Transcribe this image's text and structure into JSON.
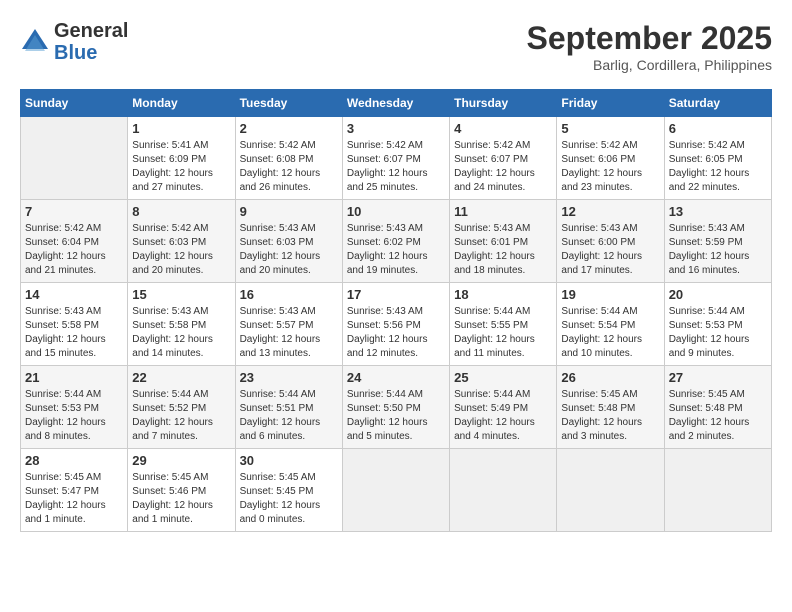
{
  "header": {
    "logo_general": "General",
    "logo_blue": "Blue",
    "month_title": "September 2025",
    "subtitle": "Barlig, Cordillera, Philippines"
  },
  "weekdays": [
    "Sunday",
    "Monday",
    "Tuesday",
    "Wednesday",
    "Thursday",
    "Friday",
    "Saturday"
  ],
  "weeks": [
    [
      {
        "day": "",
        "sunrise": "",
        "sunset": "",
        "daylight": ""
      },
      {
        "day": "1",
        "sunrise": "Sunrise: 5:41 AM",
        "sunset": "Sunset: 6:09 PM",
        "daylight": "Daylight: 12 hours and 27 minutes."
      },
      {
        "day": "2",
        "sunrise": "Sunrise: 5:42 AM",
        "sunset": "Sunset: 6:08 PM",
        "daylight": "Daylight: 12 hours and 26 minutes."
      },
      {
        "day": "3",
        "sunrise": "Sunrise: 5:42 AM",
        "sunset": "Sunset: 6:07 PM",
        "daylight": "Daylight: 12 hours and 25 minutes."
      },
      {
        "day": "4",
        "sunrise": "Sunrise: 5:42 AM",
        "sunset": "Sunset: 6:07 PM",
        "daylight": "Daylight: 12 hours and 24 minutes."
      },
      {
        "day": "5",
        "sunrise": "Sunrise: 5:42 AM",
        "sunset": "Sunset: 6:06 PM",
        "daylight": "Daylight: 12 hours and 23 minutes."
      },
      {
        "day": "6",
        "sunrise": "Sunrise: 5:42 AM",
        "sunset": "Sunset: 6:05 PM",
        "daylight": "Daylight: 12 hours and 22 minutes."
      }
    ],
    [
      {
        "day": "7",
        "sunrise": "Sunrise: 5:42 AM",
        "sunset": "Sunset: 6:04 PM",
        "daylight": "Daylight: 12 hours and 21 minutes."
      },
      {
        "day": "8",
        "sunrise": "Sunrise: 5:42 AM",
        "sunset": "Sunset: 6:03 PM",
        "daylight": "Daylight: 12 hours and 20 minutes."
      },
      {
        "day": "9",
        "sunrise": "Sunrise: 5:43 AM",
        "sunset": "Sunset: 6:03 PM",
        "daylight": "Daylight: 12 hours and 20 minutes."
      },
      {
        "day": "10",
        "sunrise": "Sunrise: 5:43 AM",
        "sunset": "Sunset: 6:02 PM",
        "daylight": "Daylight: 12 hours and 19 minutes."
      },
      {
        "day": "11",
        "sunrise": "Sunrise: 5:43 AM",
        "sunset": "Sunset: 6:01 PM",
        "daylight": "Daylight: 12 hours and 18 minutes."
      },
      {
        "day": "12",
        "sunrise": "Sunrise: 5:43 AM",
        "sunset": "Sunset: 6:00 PM",
        "daylight": "Daylight: 12 hours and 17 minutes."
      },
      {
        "day": "13",
        "sunrise": "Sunrise: 5:43 AM",
        "sunset": "Sunset: 5:59 PM",
        "daylight": "Daylight: 12 hours and 16 minutes."
      }
    ],
    [
      {
        "day": "14",
        "sunrise": "Sunrise: 5:43 AM",
        "sunset": "Sunset: 5:58 PM",
        "daylight": "Daylight: 12 hours and 15 minutes."
      },
      {
        "day": "15",
        "sunrise": "Sunrise: 5:43 AM",
        "sunset": "Sunset: 5:58 PM",
        "daylight": "Daylight: 12 hours and 14 minutes."
      },
      {
        "day": "16",
        "sunrise": "Sunrise: 5:43 AM",
        "sunset": "Sunset: 5:57 PM",
        "daylight": "Daylight: 12 hours and 13 minutes."
      },
      {
        "day": "17",
        "sunrise": "Sunrise: 5:43 AM",
        "sunset": "Sunset: 5:56 PM",
        "daylight": "Daylight: 12 hours and 12 minutes."
      },
      {
        "day": "18",
        "sunrise": "Sunrise: 5:44 AM",
        "sunset": "Sunset: 5:55 PM",
        "daylight": "Daylight: 12 hours and 11 minutes."
      },
      {
        "day": "19",
        "sunrise": "Sunrise: 5:44 AM",
        "sunset": "Sunset: 5:54 PM",
        "daylight": "Daylight: 12 hours and 10 minutes."
      },
      {
        "day": "20",
        "sunrise": "Sunrise: 5:44 AM",
        "sunset": "Sunset: 5:53 PM",
        "daylight": "Daylight: 12 hours and 9 minutes."
      }
    ],
    [
      {
        "day": "21",
        "sunrise": "Sunrise: 5:44 AM",
        "sunset": "Sunset: 5:53 PM",
        "daylight": "Daylight: 12 hours and 8 minutes."
      },
      {
        "day": "22",
        "sunrise": "Sunrise: 5:44 AM",
        "sunset": "Sunset: 5:52 PM",
        "daylight": "Daylight: 12 hours and 7 minutes."
      },
      {
        "day": "23",
        "sunrise": "Sunrise: 5:44 AM",
        "sunset": "Sunset: 5:51 PM",
        "daylight": "Daylight: 12 hours and 6 minutes."
      },
      {
        "day": "24",
        "sunrise": "Sunrise: 5:44 AM",
        "sunset": "Sunset: 5:50 PM",
        "daylight": "Daylight: 12 hours and 5 minutes."
      },
      {
        "day": "25",
        "sunrise": "Sunrise: 5:44 AM",
        "sunset": "Sunset: 5:49 PM",
        "daylight": "Daylight: 12 hours and 4 minutes."
      },
      {
        "day": "26",
        "sunrise": "Sunrise: 5:45 AM",
        "sunset": "Sunset: 5:48 PM",
        "daylight": "Daylight: 12 hours and 3 minutes."
      },
      {
        "day": "27",
        "sunrise": "Sunrise: 5:45 AM",
        "sunset": "Sunset: 5:48 PM",
        "daylight": "Daylight: 12 hours and 2 minutes."
      }
    ],
    [
      {
        "day": "28",
        "sunrise": "Sunrise: 5:45 AM",
        "sunset": "Sunset: 5:47 PM",
        "daylight": "Daylight: 12 hours and 1 minute."
      },
      {
        "day": "29",
        "sunrise": "Sunrise: 5:45 AM",
        "sunset": "Sunset: 5:46 PM",
        "daylight": "Daylight: 12 hours and 1 minute."
      },
      {
        "day": "30",
        "sunrise": "Sunrise: 5:45 AM",
        "sunset": "Sunset: 5:45 PM",
        "daylight": "Daylight: 12 hours and 0 minutes."
      },
      {
        "day": "",
        "sunrise": "",
        "sunset": "",
        "daylight": ""
      },
      {
        "day": "",
        "sunrise": "",
        "sunset": "",
        "daylight": ""
      },
      {
        "day": "",
        "sunrise": "",
        "sunset": "",
        "daylight": ""
      },
      {
        "day": "",
        "sunrise": "",
        "sunset": "",
        "daylight": ""
      }
    ]
  ]
}
